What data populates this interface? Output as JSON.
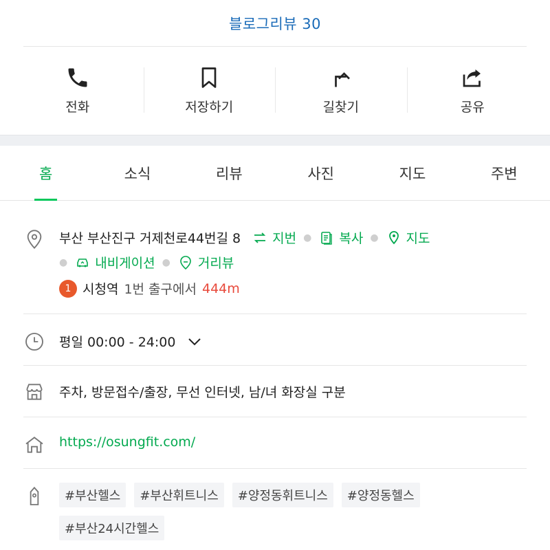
{
  "header": {
    "blog_review": "블로그리뷰 30"
  },
  "actions": [
    {
      "label": "전화",
      "icon": "phone-icon"
    },
    {
      "label": "저장하기",
      "icon": "bookmark-icon"
    },
    {
      "label": "길찾기",
      "icon": "directions-icon"
    },
    {
      "label": "공유",
      "icon": "share-icon"
    }
  ],
  "tabs": [
    {
      "label": "홈",
      "active": true
    },
    {
      "label": "소식"
    },
    {
      "label": "리뷰"
    },
    {
      "label": "사진"
    },
    {
      "label": "지도"
    },
    {
      "label": "주변"
    }
  ],
  "address": {
    "text": "부산 부산진구 거제천로44번길 8",
    "jibun_label": "지번",
    "copy_label": "복사",
    "map_label": "지도",
    "navigation_label": "내비게이션",
    "street_view_label": "거리뷰",
    "station": {
      "badge": "1",
      "name": "시청역",
      "exit": "1번 출구에서",
      "distance": "444m"
    }
  },
  "hours": {
    "text": "평일 00:00 - 24:00"
  },
  "amenities": {
    "text": "주차, 방문접수/출장, 무선 인터넷, 남/녀 화장실 구분"
  },
  "website": {
    "url": "https://osungfit.com/"
  },
  "tags": [
    "#부산헬스",
    "#부산휘트니스",
    "#양정동휘트니스",
    "#양정동헬스",
    "#부산24시간헬스"
  ],
  "colors": {
    "accent_green": "#03c75a",
    "link_blue": "#1a6bb8",
    "distance_red": "#e8493b",
    "station_badge": "#e8592c"
  }
}
